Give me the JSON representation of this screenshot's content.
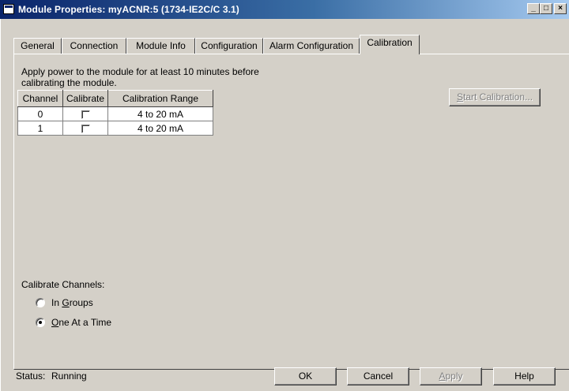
{
  "window": {
    "title": "Module Properties: myACNR:5 (1734-IE2C/C 3.1)",
    "buttons": {
      "minimize": "_",
      "maximize": "□",
      "close": "×"
    }
  },
  "tabs": [
    {
      "label": "General"
    },
    {
      "label": "Connection"
    },
    {
      "label": "Module Info"
    },
    {
      "label": "Configuration"
    },
    {
      "label": "Alarm Configuration"
    },
    {
      "label": "Calibration",
      "active": true
    }
  ],
  "calibration": {
    "instruction_line1": "Apply power to the module for at least 10 minutes before",
    "instruction_line2": "calibrating the module.",
    "columns": [
      "Channel",
      "Calibrate",
      "Calibration Range"
    ],
    "rows": [
      {
        "channel": "0",
        "calibrate": false,
        "range": "4 to 20 mA"
      },
      {
        "channel": "1",
        "calibrate": false,
        "range": "4 to 20 mA"
      }
    ],
    "start_button": {
      "before": "",
      "accel": "S",
      "after": "tart Calibration...",
      "enabled": false
    },
    "calibrate_channels_label": "Calibrate Channels:",
    "options": [
      {
        "before": "In ",
        "accel": "G",
        "after": "roups",
        "selected": false
      },
      {
        "before": "",
        "accel": "O",
        "after": "ne At a Time",
        "selected": true
      }
    ]
  },
  "status": {
    "label": "Status:",
    "value": "Running"
  },
  "footer": {
    "ok": "OK",
    "cancel": "Cancel",
    "apply": {
      "before": "",
      "accel": "A",
      "after": "pply",
      "enabled": false
    },
    "help": "Help"
  }
}
